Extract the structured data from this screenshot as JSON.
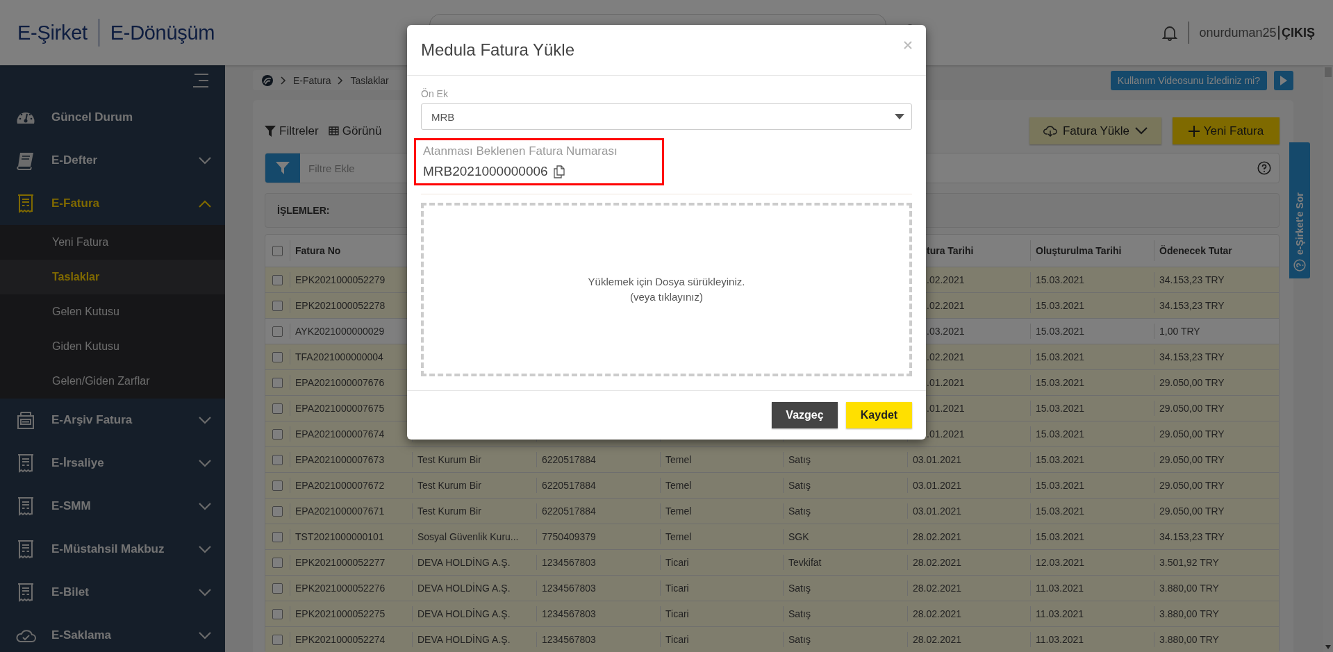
{
  "header": {
    "logo_left": "E-Şirket",
    "logo_right": "E-Dönüşüm",
    "username": "onurduman25",
    "logout": "ÇIKIŞ"
  },
  "sidebar": {
    "items": [
      {
        "label": "Güncel Durum",
        "selected": false
      },
      {
        "label": "E-Defter",
        "selected": false,
        "expanded": false
      },
      {
        "label": "E-Fatura",
        "selected": true,
        "expanded": true,
        "children": [
          {
            "label": "Yeni Fatura",
            "selected": false
          },
          {
            "label": "Taslaklar",
            "selected": true
          },
          {
            "label": "Gelen Kutusu",
            "selected": false
          },
          {
            "label": "Giden Kutusu",
            "selected": false
          },
          {
            "label": "Gelen/Giden Zarflar",
            "selected": false
          }
        ]
      },
      {
        "label": "E-Arşiv Fatura",
        "selected": false,
        "expanded": false
      },
      {
        "label": "E-İrsaliye",
        "selected": false,
        "expanded": false
      },
      {
        "label": "E-SMM",
        "selected": false,
        "expanded": false
      },
      {
        "label": "E-Müstahsil Makbuz",
        "selected": false,
        "expanded": false
      },
      {
        "label": "E-Bilet",
        "selected": false,
        "expanded": false
      },
      {
        "label": "E-Saklama",
        "selected": false,
        "expanded": false
      }
    ]
  },
  "breadcrumb": [
    "E-Fatura",
    "Taslaklar"
  ],
  "video_prompt": "Kullanım Videosunu İzlediniz mi?",
  "toolbar": {
    "filters": "Filtreler",
    "view": "Görünü",
    "upload": "Fatura Yükle",
    "new_invoice": "Yeni Fatura"
  },
  "filter_field": {
    "placeholder": "Filtre Ekle"
  },
  "actions_label": "İŞLEMLER:",
  "side_tab": "e-Şirket'e Sor",
  "table": {
    "select_all_checked": false,
    "columns": {
      "fatura_no": "Fatura No",
      "fatura_tarihi": "tura Tarihi",
      "olusturulma_tarihi": "Oluşturulma Tarihi",
      "odenecek_tutar": "Ödenecek Tutar"
    },
    "rows": [
      {
        "checked": false,
        "highlighted": true,
        "fatura_no": "EPK2021000052279",
        "fatura_tarihi": ".02.2021",
        "olusturulma_tarihi": "15.03.2021",
        "odenecek_tutar": "34.153,23 TRY"
      },
      {
        "checked": false,
        "highlighted": true,
        "fatura_no": "EPK2021000052278",
        "fatura_tarihi": ".02.2021",
        "olusturulma_tarihi": "15.03.2021",
        "odenecek_tutar": "34.153,23 TRY"
      },
      {
        "checked": false,
        "highlighted": false,
        "fatura_no": "AYK2021000000029",
        "fatura_tarihi": ".03.2021",
        "olusturulma_tarihi": "15.03.2021",
        "odenecek_tutar": "1,00 TRY"
      },
      {
        "checked": false,
        "highlighted": true,
        "fatura_no": "TFA2021000000004",
        "fatura_tarihi": ".02.2021",
        "olusturulma_tarihi": "15.03.2021",
        "odenecek_tutar": "34.153,23 TRY"
      },
      {
        "checked": false,
        "highlighted": true,
        "fatura_no": "EPA2021000007676",
        "fatura_tarihi": ".01.2021",
        "olusturulma_tarihi": "15.03.2021",
        "odenecek_tutar": "29.050,00 TRY"
      },
      {
        "checked": false,
        "highlighted": true,
        "fatura_no": "EPA2021000007675",
        "fatura_tarihi": ".01.2021",
        "olusturulma_tarihi": "15.03.2021",
        "odenecek_tutar": "29.050,00 TRY"
      },
      {
        "checked": false,
        "highlighted": true,
        "fatura_no": "EPA2021000007674",
        "fatura_tarihi": ".01.2021",
        "olusturulma_tarihi": "15.03.2021",
        "odenecek_tutar": "29.050,00 TRY"
      },
      {
        "checked": false,
        "highlighted": true,
        "fatura_no": "EPA2021000007673",
        "column_2": "Test Kurum Bir",
        "column_3": "6220517884",
        "column_4": "Temel",
        "column_5": "Satış",
        "fatura_tarihi": "03.01.2021",
        "olusturulma_tarihi": "15.03.2021",
        "odenecek_tutar": "29.050,00 TRY"
      },
      {
        "checked": false,
        "highlighted": true,
        "fatura_no": "EPA2021000007672",
        "column_2": "Test Kurum Bir",
        "column_3": "6220517884",
        "column_4": "Temel",
        "column_5": "Satış",
        "fatura_tarihi": "03.01.2021",
        "olusturulma_tarihi": "15.03.2021",
        "odenecek_tutar": "29.050,00 TRY"
      },
      {
        "checked": false,
        "highlighted": true,
        "fatura_no": "EPA2021000007671",
        "column_2": "Test Kurum Bir",
        "column_3": "6220517884",
        "column_4": "Temel",
        "column_5": "Satış",
        "fatura_tarihi": "03.01.2021",
        "olusturulma_tarihi": "15.03.2021",
        "odenecek_tutar": "29.050,00 TRY"
      },
      {
        "checked": false,
        "highlighted": true,
        "fatura_no": "TST2021000000101",
        "column_2": "Sosyal Güvenlik Kuru...",
        "column_3": "7750409379",
        "column_4": "Temel",
        "column_5": "SGK",
        "fatura_tarihi": "28.02.2021",
        "olusturulma_tarihi": "15.03.2021",
        "odenecek_tutar": "34.153,23 TRY"
      },
      {
        "checked": false,
        "highlighted": true,
        "fatura_no": "EPK2021000052277",
        "column_2": "DEVA HOLDİNG A.Ş.",
        "column_3": "1234567803",
        "column_4": "Ticari",
        "column_5": "Tevkifat",
        "fatura_tarihi": "28.02.2021",
        "olusturulma_tarihi": "12.03.2021",
        "odenecek_tutar": "3.501,92 TRY"
      },
      {
        "checked": false,
        "highlighted": true,
        "fatura_no": "EPK2021000052276",
        "column_2": "DEVA HOLDİNG A.Ş.",
        "column_3": "1234567803",
        "column_4": "Ticari",
        "column_5": "Satış",
        "fatura_tarihi": "28.02.2021",
        "olusturulma_tarihi": "11.03.2021",
        "odenecek_tutar": "3.880,00 TRY"
      },
      {
        "checked": false,
        "highlighted": true,
        "fatura_no": "EPK2021000052275",
        "column_2": "DEVA HOLDİNG A.Ş.",
        "column_3": "1234567803",
        "column_4": "Ticari",
        "column_5": "Satış",
        "fatura_tarihi": "28.02.2021",
        "olusturulma_tarihi": "11.03.2021",
        "odenecek_tutar": "3.880,00 TRY"
      },
      {
        "checked": false,
        "highlighted": true,
        "fatura_no": "EPK2021000052274",
        "column_2": "DEVA HOLDİNG A.Ş.",
        "column_3": "1234567803",
        "column_4": "Ticari",
        "column_5": "Satış",
        "fatura_tarihi": "28.02.2021",
        "olusturulma_tarihi": "11.03.2021",
        "odenecek_tutar": "3.880,00 TRY"
      }
    ]
  },
  "modal": {
    "title": "Medula Fatura Yükle",
    "prefix": {
      "label": "Ön Ek",
      "value": "MRB"
    },
    "expected_number": {
      "label": "Atanması Beklenen Fatura Numarası",
      "value": "MRB2021000000006",
      "highlighted": true
    },
    "dropzone": {
      "text": "Yüklemek için Dosya sürükleyiniz.",
      "hint": "(veya tıklayınız)"
    },
    "buttons": [
      {
        "label": "Vazgeç",
        "kind": "secondary"
      },
      {
        "label": "Kaydet",
        "kind": "primary"
      }
    ]
  }
}
